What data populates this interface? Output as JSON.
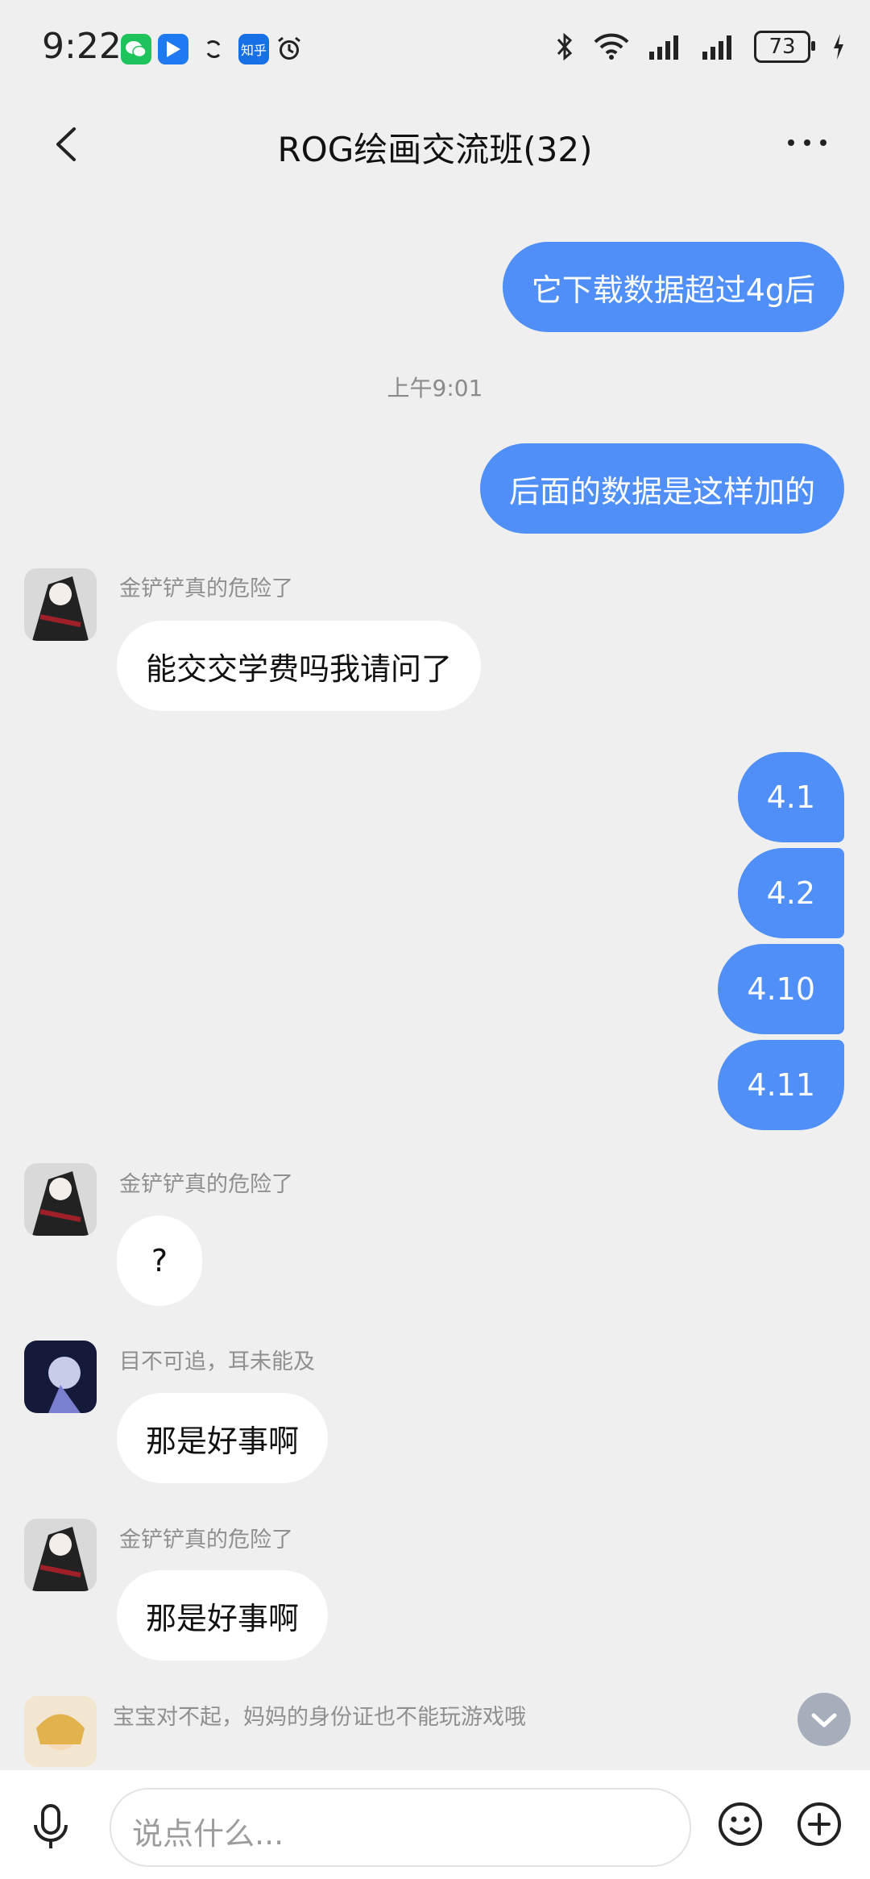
{
  "status_bar": {
    "time": "9:22",
    "app_icons": [
      "wechat-icon",
      "feishu-icon",
      "sync-icon",
      "zhihu-icon",
      "alarm-icon"
    ],
    "zhihu_text": "知乎",
    "battery": "73"
  },
  "header": {
    "title": "ROG绘画交流班(32)"
  },
  "messages": {
    "m1": "它下载数据超过4g后",
    "timestamp": "上午9:01",
    "m2": "后面的数据是这样加的",
    "m3_sender": "金铲铲真的危险了",
    "m3": "能交交学费吗我请问了",
    "m4": "4.1",
    "m5": "4.2",
    "m6": "4.10",
    "m7": "4.11",
    "m8_sender": "金铲铲真的危险了",
    "m8": "?",
    "m9_sender": "目不可追，耳未能及",
    "m9": "那是好事啊",
    "m10_sender": "金铲铲真的危险了",
    "m10": "那是好事啊",
    "m11_sender": "宝宝对不起，妈妈的身份证也不能玩游戏哦"
  },
  "input": {
    "placeholder": "说点什么..."
  },
  "colors": {
    "outgoing_bubble": "#4f8ff7",
    "incoming_bubble": "#ffffff",
    "background": "#efefef"
  }
}
